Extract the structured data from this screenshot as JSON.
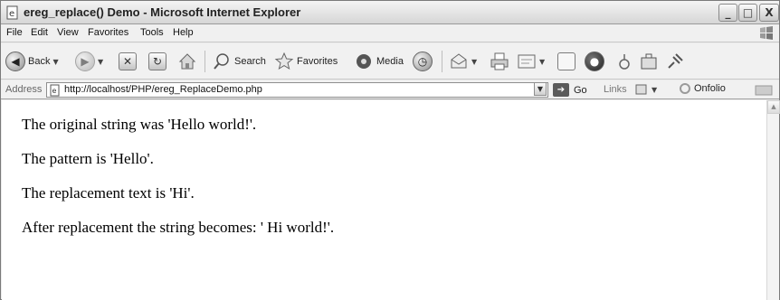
{
  "window": {
    "title": "ereg_replace() Demo - Microsoft Internet Explorer",
    "controls": {
      "minimize": "_",
      "maximize": "□",
      "close": "X"
    }
  },
  "menu": [
    "File",
    "Edit",
    "View",
    "Favorites",
    "Tools",
    "Help"
  ],
  "toolbar": {
    "back_label": "Back",
    "search_label": "Search",
    "favorites_label": "Favorites",
    "media_label": "Media"
  },
  "address": {
    "label": "Address",
    "url": "http://localhost/PHP/ereg_ReplaceDemo.php",
    "go_label": "Go",
    "links_label": "Links",
    "onfolio_label": "Onfolio"
  },
  "page": {
    "lines": [
      "The original string was 'Hello world!'.",
      "The pattern is 'Hello'.",
      "The replacement text is 'Hi'.",
      "After replacement the string becomes: ' Hi world!'."
    ]
  }
}
